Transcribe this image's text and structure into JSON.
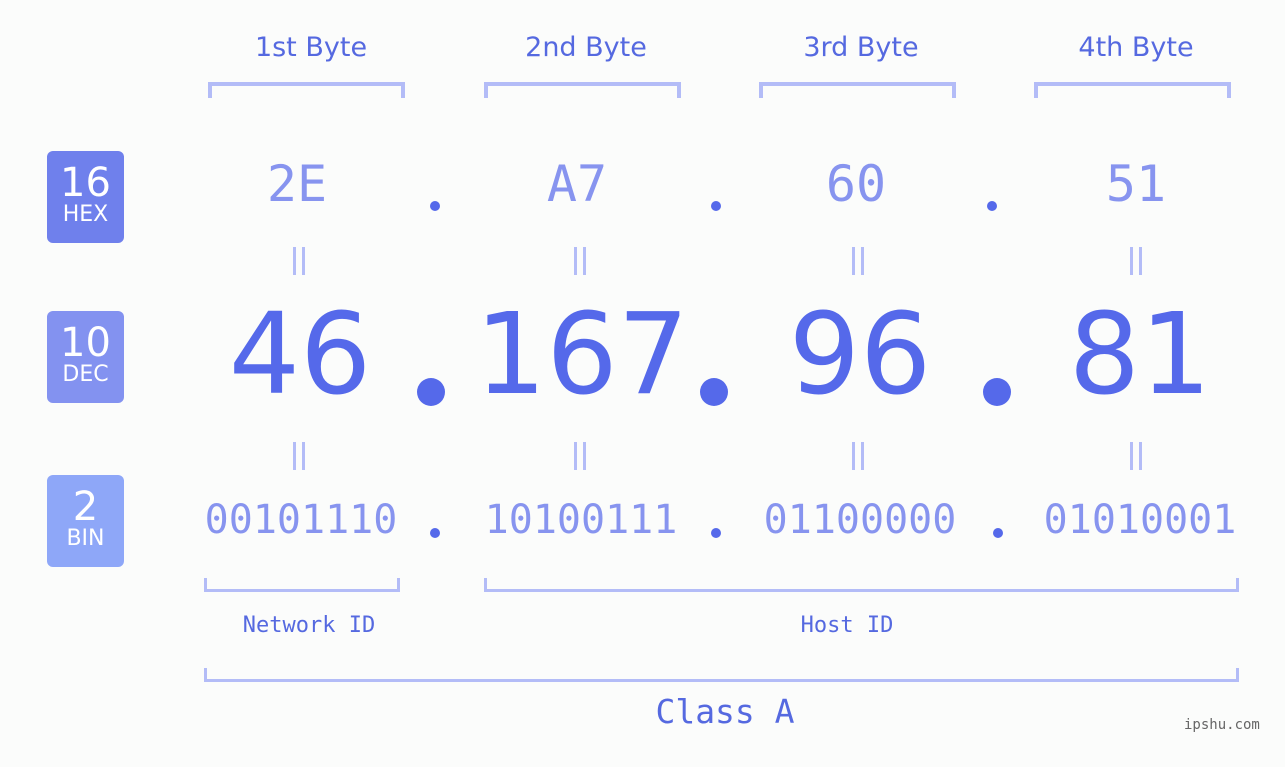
{
  "badges": [
    {
      "num": "16",
      "label": "HEX",
      "color": "#6f80ec"
    },
    {
      "num": "10",
      "label": "DEC",
      "color": "#8392f0"
    },
    {
      "num": "2",
      "label": "BIN",
      "color": "#8ea7f8"
    }
  ],
  "bytes": [
    {
      "header": "1st Byte",
      "hex": "2E",
      "dec": "46",
      "bin": "00101110"
    },
    {
      "header": "2nd Byte",
      "hex": "A7",
      "dec": "167",
      "bin": "10100111"
    },
    {
      "header": "3rd Byte",
      "hex": "60",
      "dec": "96",
      "bin": "01100000"
    },
    {
      "header": "4th Byte",
      "hex": "51",
      "dec": "81",
      "bin": "01010001"
    }
  ],
  "network_id_label": "Network ID",
  "host_id_label": "Host ID",
  "class_label": "Class A",
  "watermark": "ipshu.com",
  "colors": {
    "accent": "#5569ea",
    "light": "#8794ef",
    "bracket": "#b3bcf7"
  }
}
